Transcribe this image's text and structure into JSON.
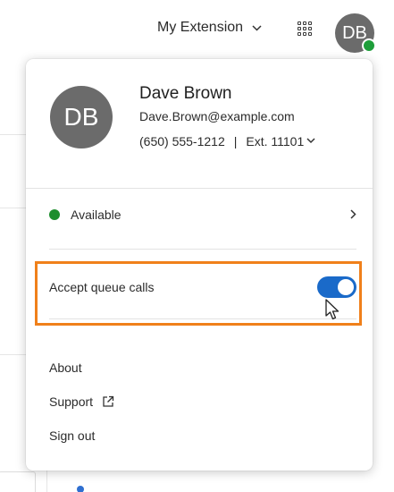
{
  "header": {
    "extension_selector": "My Extension",
    "user_initials": "DB",
    "apps_icon": "grid-icon",
    "colors": {
      "avatar_bg": "#6b6b6b",
      "presence": "#1e9e3a"
    }
  },
  "profile": {
    "initials": "DB",
    "name": "Dave Brown",
    "email": "Dave.Brown@example.com",
    "phone": "(650) 555-1212",
    "separator": "|",
    "extension": "Ext. 11101"
  },
  "status": {
    "label": "Available",
    "color": "#1e8e2e"
  },
  "queue": {
    "label": "Accept queue calls",
    "toggle_on": true,
    "highlight_color": "#f0801a",
    "toggle_color": "#1a6ac9"
  },
  "menu": {
    "about": "About",
    "support": "Support",
    "sign_out": "Sign out"
  }
}
